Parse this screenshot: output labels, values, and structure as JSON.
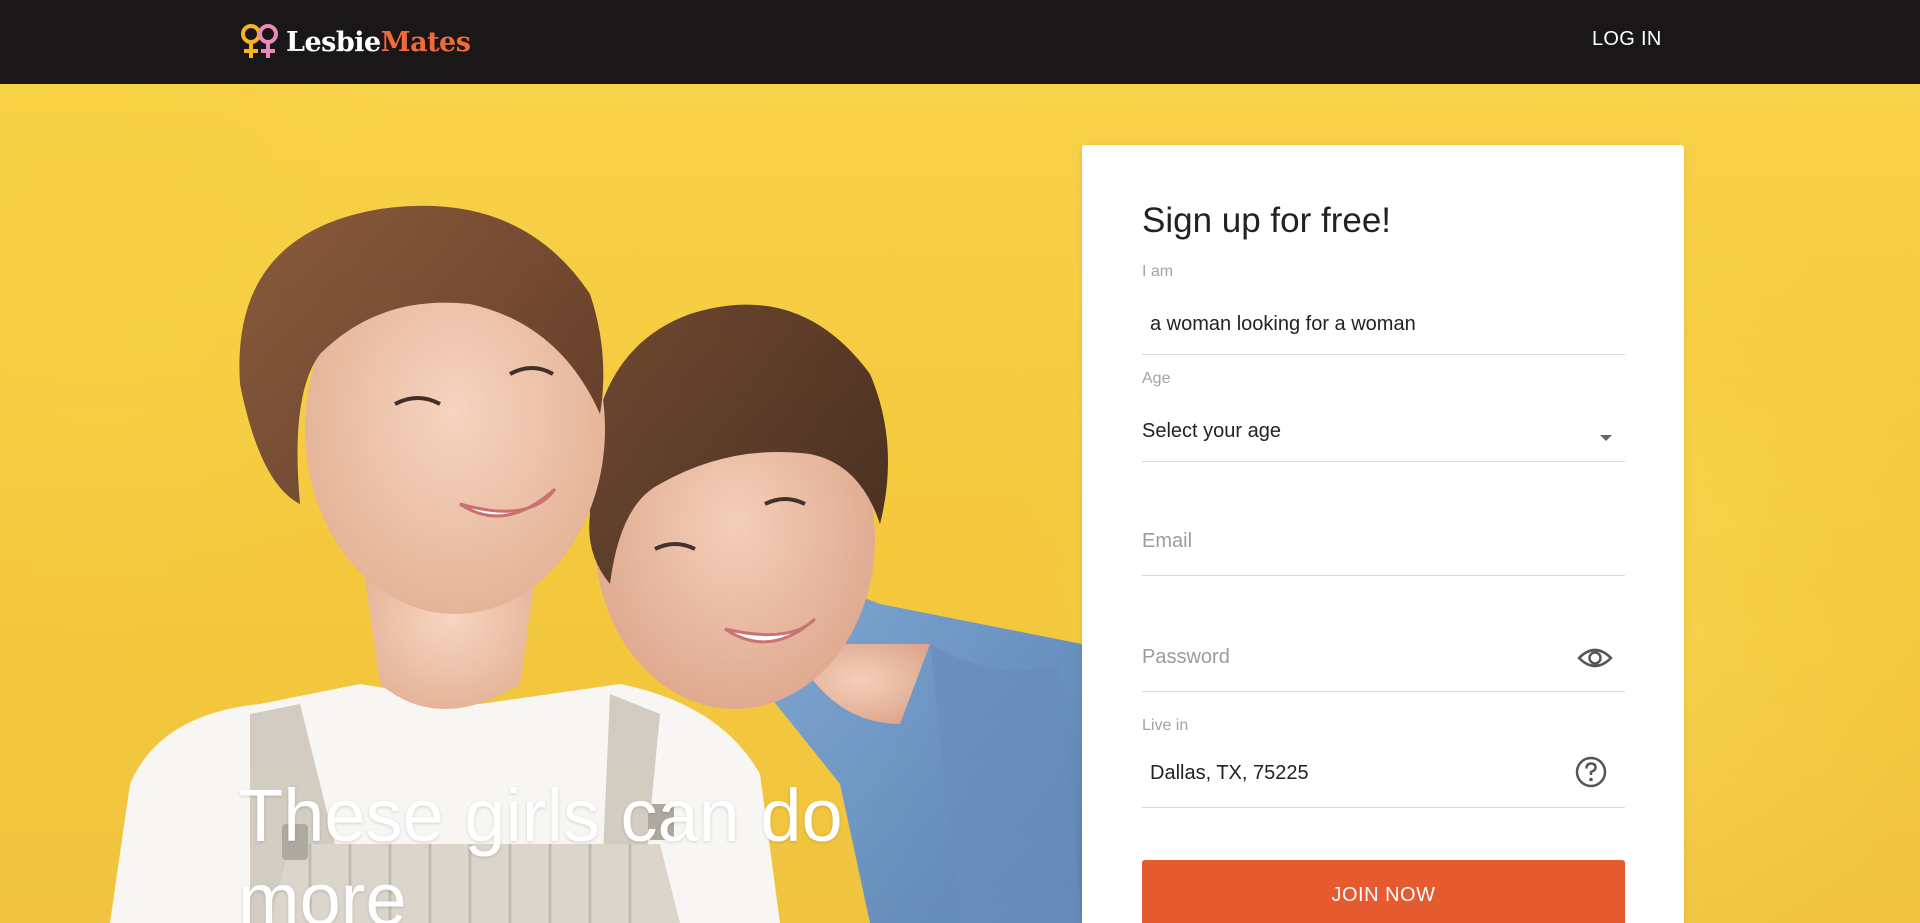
{
  "header": {
    "logo": {
      "part1": "Lesbie",
      "part2": "Mates",
      "icon": "female-symbols-icon"
    },
    "login_label": "LOG IN"
  },
  "hero": {
    "headline": "These girls can do more"
  },
  "signup": {
    "title": "Sign up for free!",
    "i_am": {
      "label": "I am",
      "value": "a woman looking for a woman"
    },
    "age": {
      "label": "Age",
      "value": "Select your age",
      "icon": "caret-down-icon"
    },
    "email": {
      "placeholder": "Email"
    },
    "password": {
      "placeholder": "Password",
      "icon": "eye-icon"
    },
    "live_in": {
      "label": "Live in",
      "value": "Dallas, TX, 75225",
      "icon": "question-circle-icon"
    },
    "join_label": "JOIN NOW"
  },
  "colors": {
    "topbar": "#1a1718",
    "background": "#f5c93a",
    "accent": "#e55a2e",
    "logo_orange": "#f06a3b",
    "logo_yellow": "#f5b423",
    "logo_pink": "#e88bb8"
  }
}
